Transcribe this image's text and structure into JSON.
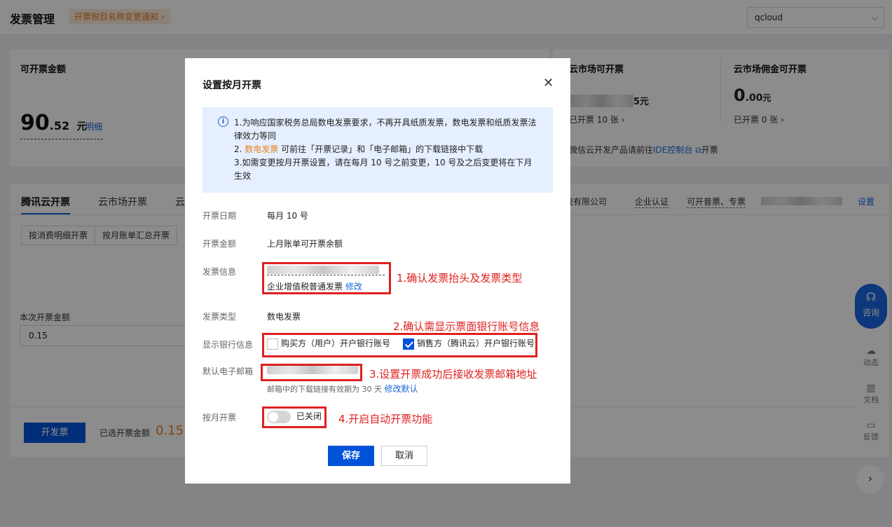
{
  "header": {
    "title": "发票管理",
    "notice": "开票税目名称变更通知 ›",
    "account": "qcloud"
  },
  "amount_panel": {
    "label": "可开票金额",
    "value_int": "90",
    "value_dec": ".52",
    "unit": "元",
    "detail_link": "明细"
  },
  "market_panel": {
    "label_left": "云市场可开票",
    "value_left_suffix": "5元",
    "issued_left": "已开票  10  张 ›",
    "label_right": "云市场佣金可开票",
    "value_right_int": "0",
    "value_right_dec": ".00",
    "value_right_unit": "元",
    "issued_right": "已开票  0  张 ›",
    "note_prefix": "微信云开发产品请前往",
    "note_link": "IDE控制台",
    "note_suffix": "开票"
  },
  "tabs": {
    "items": [
      "腾讯云开票",
      "云市场开票",
      "云"
    ],
    "right_company": "系统有限公司",
    "right_cert": "企业认证",
    "right_types": "可开普票、专票",
    "right_settings": "设置"
  },
  "subtabs": [
    "按消费明细开票",
    "按月账单汇总开票"
  ],
  "current_amount": {
    "label": "本次开票金额",
    "value": "0.15"
  },
  "footer": {
    "issue_button": "开发票",
    "selected_label": "已选开票金额",
    "selected_value": "0.15"
  },
  "side": {
    "consult": "咨询",
    "news": "动态",
    "docs": "文档",
    "feedback": "反馈"
  },
  "modal": {
    "title": "设置按月开票",
    "alert": {
      "line1": "1.为响应国家税务总局数电发票要求，不再开具纸质发票，数电发票和纸质发票法律效力等同",
      "line2_prefix": "2. ",
      "line2_highlight": "数电发票",
      "line2_suffix": " 可前往「开票记录」和「电子邮箱」的下载链接中下载",
      "line3": "3.如需变更按月开票设置，请在每月 10 号之前变更，10 号及之后变更将在下月生效"
    },
    "rows": {
      "date_label": "开票日期",
      "date_value": "每月 10 号",
      "amount_label": "开票金额",
      "amount_value": "上月账单可开票余额",
      "info_label": "发票信息",
      "info_type": "企业增值税普通发票",
      "info_edit": "修改",
      "type_label": "发票类型",
      "type_value": "数电发票",
      "bank_label": "显示银行信息",
      "bank_buyer": "购买方（用户）开户银行账号",
      "bank_seller": "销售方（腾讯云）开户银行账号",
      "email_label": "默认电子邮箱",
      "email_hint": "邮箱中的下载链接有效期为 30 天",
      "email_edit": "修改默认",
      "monthly_label": "按月开票",
      "monthly_state": "已关闭"
    },
    "save": "保存",
    "cancel": "取消"
  },
  "annotations": {
    "a1": "1.确认发票抬头及发票类型",
    "a2": "2.确认需显示票面银行账号信息",
    "a3": "3.设置开票成功后接收发票邮箱地址",
    "a4": "4.开启自动开票功能"
  }
}
